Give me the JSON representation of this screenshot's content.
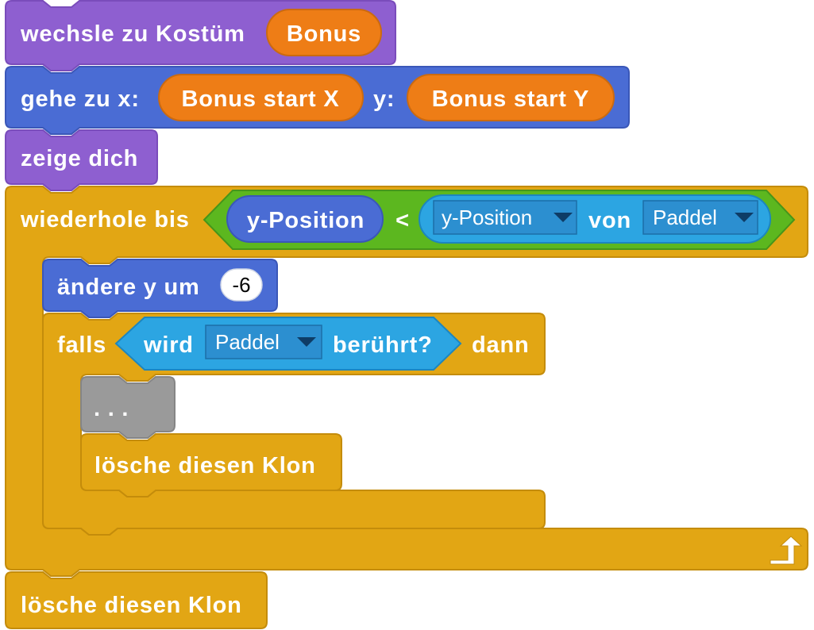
{
  "colors": {
    "looks": "#8E5FD0",
    "looks_edge": "#7A4CBB",
    "motion": "#4A6CD4",
    "motion_edge": "#3A57B8",
    "control": "#E2A614",
    "control_edge": "#C48C0B",
    "operators": "#5CB71F",
    "operators_edge": "#46951A",
    "sensing": "#2CA5E2",
    "sensing_edge": "#1D86BE",
    "variables": "#EE7D16",
    "variables_edge": "#CB6A10",
    "placeholder": "#9A9A9A",
    "dropdown_bg": "#2C8FD0"
  },
  "blocks": {
    "switch_costume": {
      "label": "wechsle zu Kostüm",
      "reporter": "Bonus"
    },
    "goto_xy": {
      "label_x": "gehe zu x:",
      "reporter_x": "Bonus start X",
      "label_y": "y:",
      "reporter_y": "Bonus start Y"
    },
    "show": {
      "label": "zeige dich"
    },
    "repeat_until": {
      "label": "wiederhole bis",
      "condition": {
        "left_reporter": "y-Position",
        "operator": "<",
        "right": {
          "attribute": "y-Position",
          "connector": "von",
          "object": "Paddel"
        }
      },
      "loop_icon": "loop-arrow-icon"
    },
    "change_y": {
      "label": "ändere y um",
      "value": "-6"
    },
    "if_touching": {
      "label_if": "falls",
      "condition": {
        "label_pre": "wird",
        "object": "Paddel",
        "label_post": "berührt?"
      },
      "label_then": "dann"
    },
    "placeholder": {
      "label": ". . ."
    },
    "delete_clone_inner": {
      "label": "lösche diesen Klon"
    },
    "delete_clone_final": {
      "label": "lösche diesen Klon"
    }
  }
}
